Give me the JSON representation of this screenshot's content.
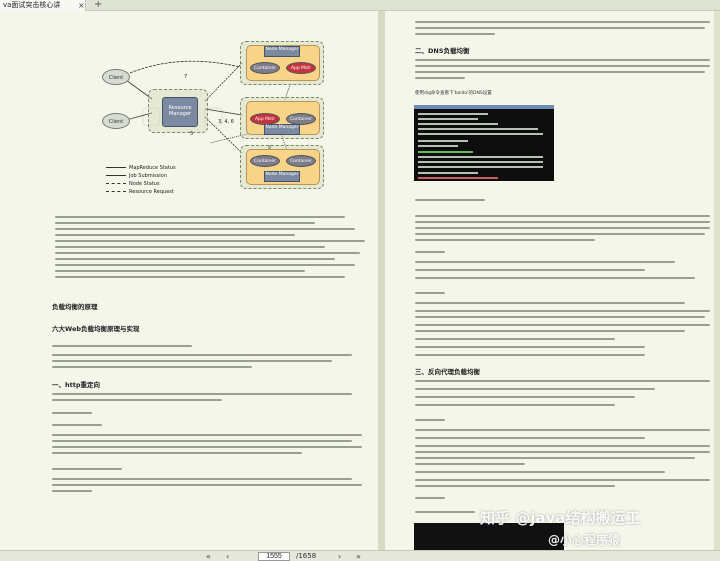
{
  "tab": {
    "title": "va面试突击核心讲",
    "close": "×",
    "new": "+"
  },
  "diagram": {
    "client1": "Client",
    "client2": "Client",
    "resource_manager": "Resource Manager",
    "node_manager_1": "Node Manager",
    "node_manager_2": "Node Manager",
    "node_manager_3": "Node Manager",
    "container": "Container",
    "app_mstr": "App Mstr",
    "edge_label_7": "7",
    "edge_label_5": "5",
    "edge_label_346": "3, 4, 6",
    "edge_label_8": "8",
    "legend": [
      "MapReduce Status",
      "Job Submission",
      "Node Status",
      "Resource Request"
    ]
  },
  "headings": {
    "lb_principle": "负载均衡的原理",
    "six_web": "六大Web负载均衡原理与实现",
    "http_redirect": "一、http重定向",
    "dns_lb": "二、DNS负载均衡",
    "reverse_proxy": "三、反向代理负载均衡"
  },
  "terminal_caption": "使用dig命令查看下'baidu'的DNS设置",
  "statusbar": {
    "prev": "‹",
    "next": "›",
    "current_page": "1555",
    "total_pages": "/1658",
    "first": "«",
    "last": "»"
  },
  "watermark": {
    "line1": "知乎 @java结构搬运工",
    "line2": "@小心程序猿"
  }
}
